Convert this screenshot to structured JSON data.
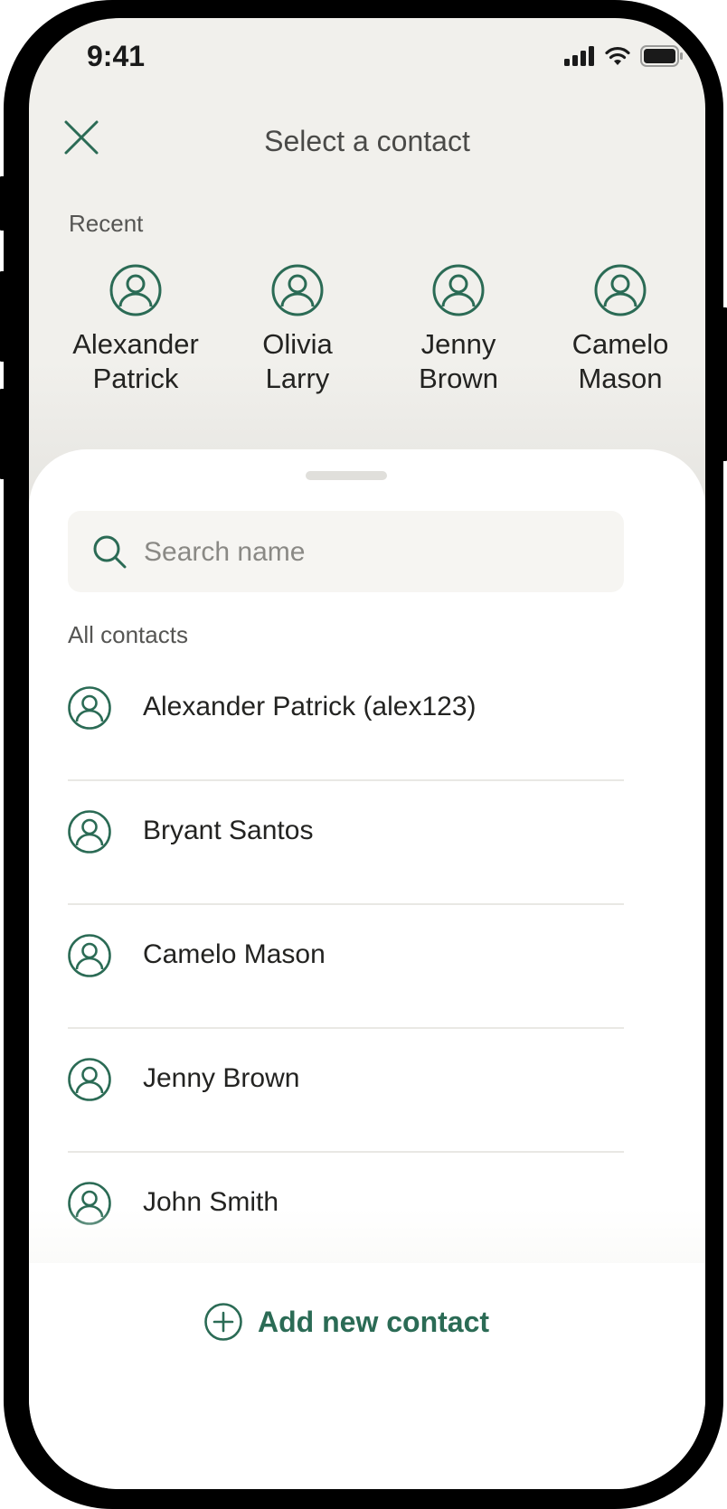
{
  "status_bar": {
    "time": "9:41",
    "icons": [
      "cellular-signal-icon",
      "wifi-icon",
      "battery-icon"
    ]
  },
  "header": {
    "title": "Select a contact",
    "close_icon": "close-icon"
  },
  "recent": {
    "label": "Recent",
    "items": [
      {
        "name": "Alexander\nPatrick"
      },
      {
        "name": "Olivia\nLarry"
      },
      {
        "name": "Jenny\nBrown"
      },
      {
        "name": "Camelo\nMason"
      }
    ]
  },
  "search": {
    "placeholder": "Search name",
    "value": ""
  },
  "contacts": {
    "label": "All contacts",
    "items": [
      {
        "name": "Alexander Patrick (alex123)"
      },
      {
        "name": "Bryant Santos"
      },
      {
        "name": "Camelo Mason"
      },
      {
        "name": "Jenny Brown"
      },
      {
        "name": "John Smith"
      }
    ]
  },
  "footer": {
    "add_label": "Add new contact"
  },
  "colors": {
    "accent": "#2b6b55",
    "background": "#f1f0ec",
    "sheet": "#ffffff"
  }
}
